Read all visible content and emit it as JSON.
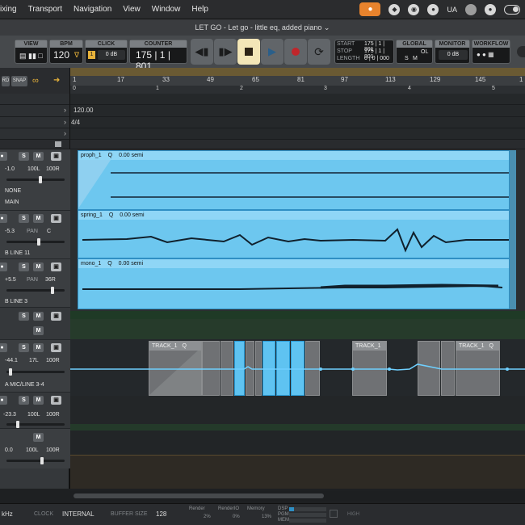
{
  "menubar": {
    "items": [
      "ixing",
      "Transport",
      "Navigation",
      "View",
      "Window",
      "Help"
    ],
    "status_text": "UA",
    "icons": [
      "mic-icon",
      "dropbox-icon",
      "vpn-icon",
      "creative-cloud-icon",
      "ua-icon",
      "moon-icon",
      "info-icon",
      "toggle-icon"
    ]
  },
  "window": {
    "title": "LET GO - Let go - little eq, added piano ⌄"
  },
  "transport": {
    "view_label": "VIEW",
    "bpm_label": "BPM",
    "bpm_value": "120",
    "click_label": "CLICK",
    "click_value": "0 dB",
    "click_badge": "1",
    "counter_label": "COUNTER",
    "counter_value": "175 | 1 | 801",
    "start_label": "START",
    "stop_label": "STOP",
    "length_label": "LENGTH",
    "start_value": "175 | 1 | 801",
    "stop_value": "175 | 1 | 801",
    "length_value": "0 | 0 | 000",
    "global_label": "GLOBAL",
    "global_s": "S",
    "global_m": "M",
    "global_ol": "OL",
    "monitor_label": "MONITOR",
    "monitor_value": "0 dB",
    "workflow_label": "WORKFLOW"
  },
  "toolbar": {
    "snap_label": "SNAP",
    "grid_label": "RD"
  },
  "ruler": {
    "bars": [
      "1",
      "17",
      "33",
      "49",
      "65",
      "81",
      "97",
      "113",
      "129",
      "145",
      "1"
    ],
    "times": [
      "0",
      "1",
      "2",
      "3",
      "4",
      "5"
    ]
  },
  "lanes": {
    "tempo": "120.00",
    "signature": "4/4"
  },
  "tracks": [
    {
      "volume": "-1.0",
      "pan_left": "100L",
      "pan_right": "100R",
      "input": "NONE",
      "output": "MAIN",
      "solo": "S",
      "mute": "M"
    },
    {
      "volume": "-5.3",
      "pan_label": "PAN",
      "pan_value": "C",
      "input": "B LINE 11",
      "solo": "S",
      "mute": "M"
    },
    {
      "volume": "+5.5",
      "pan_label": "PAN",
      "pan_value": "36R",
      "input": "B LINE 3",
      "solo": "S",
      "mute": "M"
    },
    {
      "solo": "S",
      "mute": "M"
    },
    {
      "volume": "-44.1",
      "pan_left": "17L",
      "pan_right": "100R",
      "input": "A MIC/LINE 3-4",
      "solo": "S",
      "mute": "M"
    },
    {
      "volume": "-23.3",
      "pan_left": "100L",
      "pan_right": "100R",
      "solo": "S",
      "mute": "M"
    },
    {
      "volume": "0.0",
      "pan_left": "100L",
      "pan_right": "100R",
      "mute": "M"
    }
  ],
  "clips": {
    "proph": {
      "name": "proph_1",
      "q": "Q",
      "pitch": "0.00 semi"
    },
    "spring": {
      "name": "spring_1",
      "q": "Q",
      "pitch": "0.00 semi"
    },
    "mono": {
      "name": "mono_1",
      "q": "Q",
      "pitch": "0.00 semi"
    },
    "track_a": {
      "name": "TRACK_1",
      "q": "Q"
    },
    "track_b": {
      "name": "TRACK_1"
    },
    "track_c": {
      "name": "TRACK_1",
      "q": "Q"
    }
  },
  "status": {
    "rate": "kHz",
    "clock_label": "CLOCK",
    "clock_value": "INTERNAL",
    "buffer_label": "BUFFER SIZE",
    "buffer_value": "128",
    "render_label": "Render",
    "render_value": "2%",
    "renderio_label": "RenderIO",
    "renderio_value": "0%",
    "memory_label": "Memory",
    "memory_value": "13%",
    "dsp_label": "DSP",
    "pgm_label": "PGM",
    "mem_label": "MEM",
    "high_label": "HIGH"
  },
  "colors": {
    "accent_orange": "#e8832d",
    "clip_blue": "#6dc7ef",
    "record_red": "#c0262b",
    "stop_cream": "#f3e6b7"
  }
}
